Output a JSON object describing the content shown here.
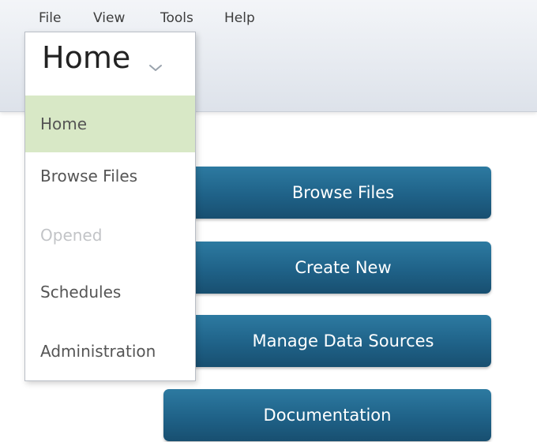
{
  "menubar": {
    "items": [
      "File",
      "View",
      "Tools",
      "Help"
    ]
  },
  "perspective": {
    "current": "Home",
    "chevron_icon": "chevron-down-icon",
    "items": [
      {
        "label": "Home",
        "state": "selected"
      },
      {
        "label": "Browse Files",
        "state": "normal"
      },
      {
        "label": "Opened",
        "state": "disabled"
      },
      {
        "label": "Schedules",
        "state": "normal"
      },
      {
        "label": "Administration",
        "state": "normal"
      }
    ]
  },
  "main": {
    "buttons": [
      "Browse Files",
      "Create New",
      "Manage Data Sources",
      "Documentation"
    ]
  },
  "colors": {
    "button_primary": "#1f6288",
    "selected_item_bg": "#d8e8c6",
    "disabled_text": "#c2c4c7",
    "header_bg": "#e6eaf0"
  }
}
